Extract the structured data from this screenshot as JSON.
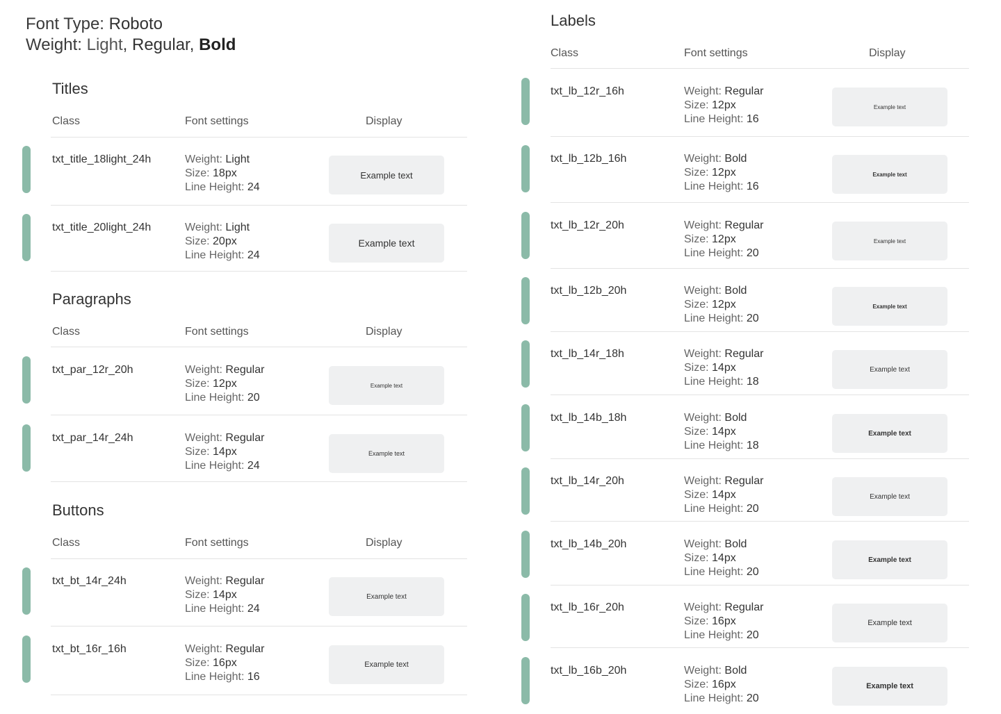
{
  "header": {
    "font_type_label": "Font Type: ",
    "font_type_value": "Roboto",
    "weight_label": "Weight: ",
    "weight_light": "Light",
    "weight_sep1": ", ",
    "weight_regular": "Regular",
    "weight_sep2": ", ",
    "weight_bold": "Bold"
  },
  "columns": {
    "class": "Class",
    "font_settings": "Font settings",
    "display": "Display"
  },
  "settings_labels": {
    "weight": "Weight: ",
    "size": "Size: ",
    "line_height": "Line Height: "
  },
  "accent_color": "#8bbaa8",
  "chip_color": "#eff0f1",
  "sections": {
    "titles": {
      "title": "Titles",
      "rows": [
        {
          "class": "txt_title_18light_24h",
          "weight": "Light",
          "size": "18px",
          "line_height": "24",
          "example": "Example text"
        },
        {
          "class": "txt_title_20light_24h",
          "weight": "Light",
          "size": "20px",
          "line_height": "24",
          "example": "Example text"
        }
      ]
    },
    "paragraphs": {
      "title": "Paragraphs",
      "rows": [
        {
          "class": "txt_par_12r_20h",
          "weight": "Regular",
          "size": "12px",
          "line_height": "20",
          "example": "Example text"
        },
        {
          "class": "txt_par_14r_24h",
          "weight": "Regular",
          "size": "14px",
          "line_height": "24",
          "example": "Example text"
        }
      ]
    },
    "buttons": {
      "title": "Buttons",
      "rows": [
        {
          "class": "txt_bt_14r_24h",
          "weight": "Regular",
          "size": "14px",
          "line_height": "24",
          "example": "Example text"
        },
        {
          "class": "txt_bt_16r_16h",
          "weight": "Regular",
          "size": "16px",
          "line_height": "16",
          "example": "Example text"
        }
      ]
    },
    "labels": {
      "title": "Labels",
      "rows": [
        {
          "class": "txt_lb_12r_16h",
          "weight": "Regular",
          "size": "12px",
          "line_height": "16",
          "example": "Example text"
        },
        {
          "class": "txt_lb_12b_16h",
          "weight": "Bold",
          "size": "12px",
          "line_height": "16",
          "example": "Example text"
        },
        {
          "class": "txt_lb_12r_20h",
          "weight": "Regular",
          "size": "12px",
          "line_height": "20",
          "example": "Example text"
        },
        {
          "class": "txt_lb_12b_20h",
          "weight": "Bold",
          "size": "12px",
          "line_height": "20",
          "example": "Example text"
        },
        {
          "class": "txt_lb_14r_18h",
          "weight": "Regular",
          "size": "14px",
          "line_height": "18",
          "example": "Example text"
        },
        {
          "class": "txt_lb_14b_18h",
          "weight": "Bold",
          "size": "14px",
          "line_height": "18",
          "example": "Example text"
        },
        {
          "class": "txt_lb_14r_20h",
          "weight": "Regular",
          "size": "14px",
          "line_height": "20",
          "example": "Example text"
        },
        {
          "class": "txt_lb_14b_20h",
          "weight": "Bold",
          "size": "14px",
          "line_height": "20",
          "example": "Example text"
        },
        {
          "class": "txt_lb_16r_20h",
          "weight": "Regular",
          "size": "16px",
          "line_height": "20",
          "example": "Example text"
        },
        {
          "class": "txt_lb_16b_20h",
          "weight": "Bold",
          "size": "16px",
          "line_height": "20",
          "example": "Example text"
        }
      ]
    }
  }
}
